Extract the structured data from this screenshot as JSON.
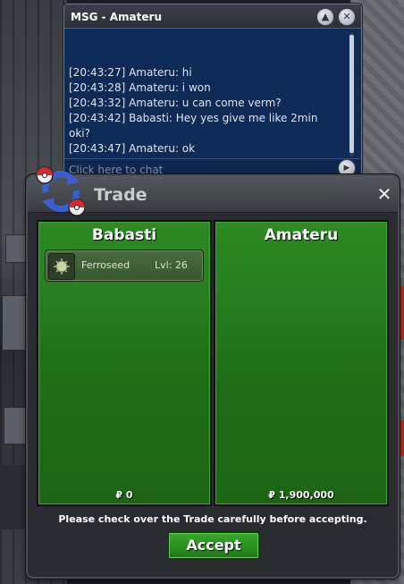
{
  "chat": {
    "title": "MSG - Amateru",
    "messages": [
      "[20:43:27] Amateru: hi",
      "[20:43:28] Amateru: i won",
      "[20:43:32] Amateru: u can come verm?",
      "[20:43:42] Babasti: Hey yes give me like 2min oki?",
      "[20:43:47] Amateru: ok"
    ],
    "input_placeholder": "Click here to chat"
  },
  "trade": {
    "title": "Trade",
    "left": {
      "player": "Babasti",
      "pokemon": {
        "name": "Ferroseed",
        "level": "Lvl: 26"
      },
      "money": "₽ 0"
    },
    "right": {
      "player": "Amateru",
      "money": "₽ 1,900,000"
    },
    "note": "Please check over the Trade carefully before accepting.",
    "accept_label": "Accept"
  },
  "colors": {
    "panel_green": "#2d8a23",
    "chat_blue": "#0e2b57",
    "accept_green": "#38a92c"
  }
}
